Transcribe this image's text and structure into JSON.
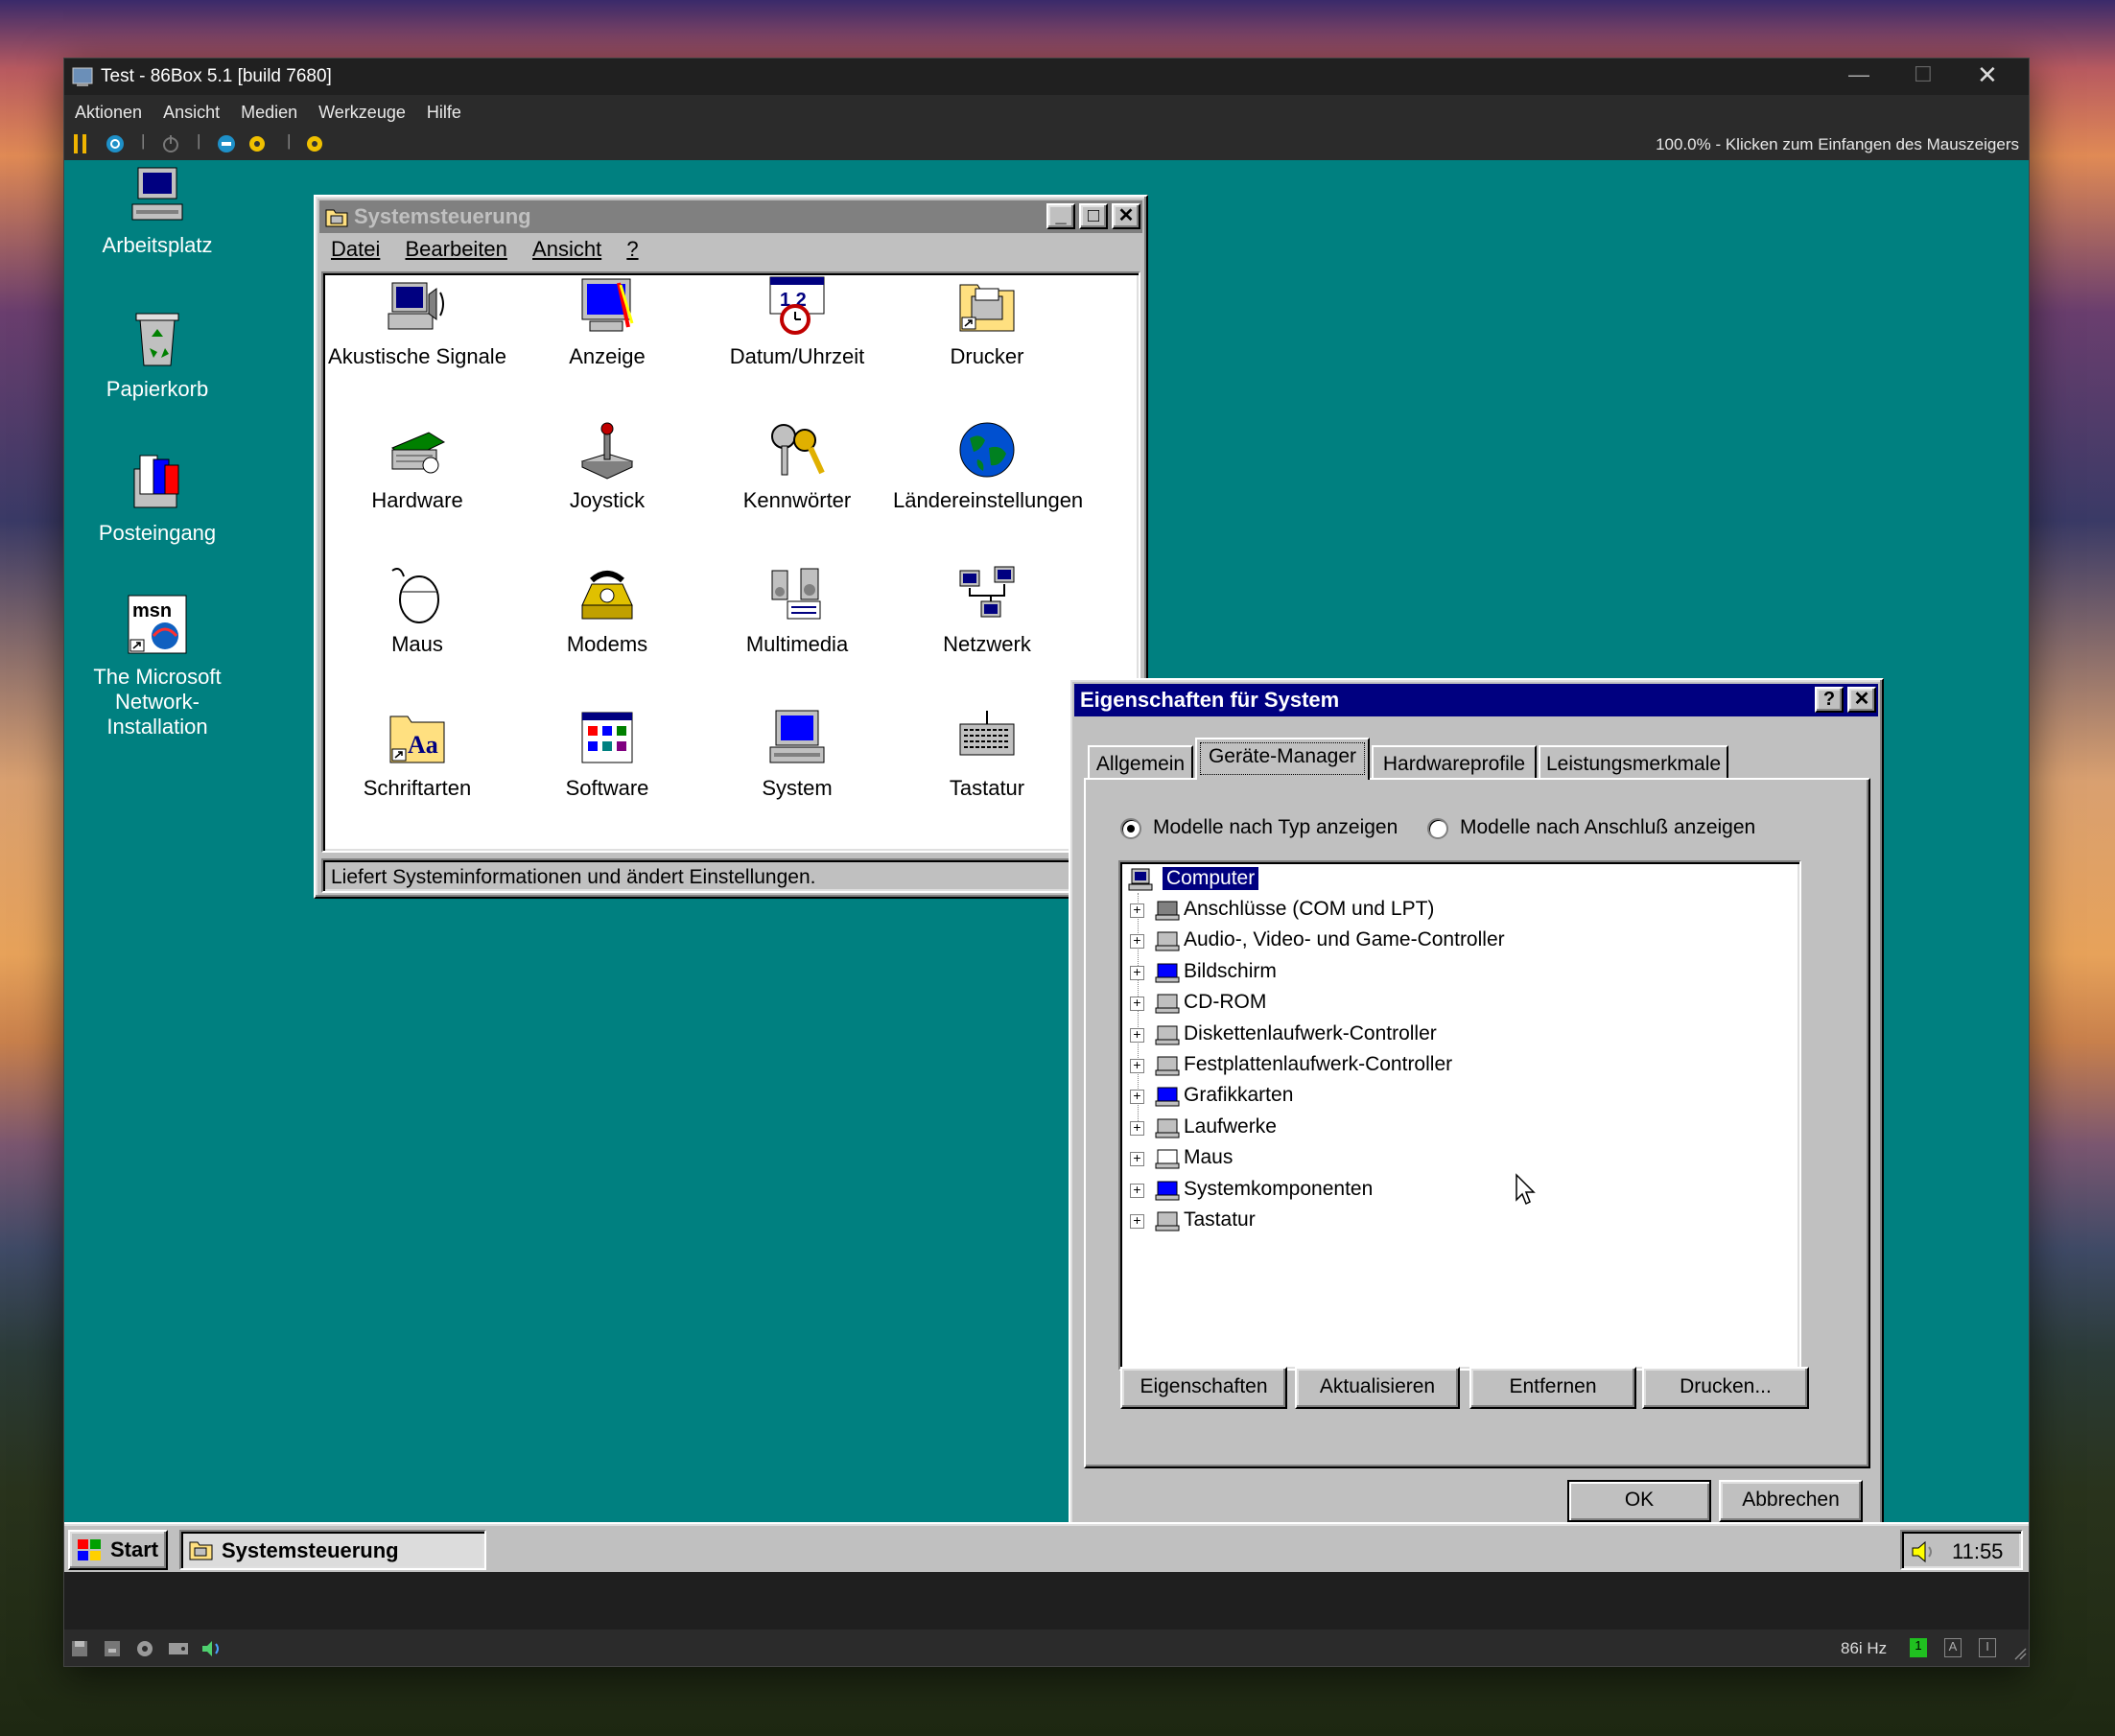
{
  "host": {
    "title": "Test - 86Box 5.1 [build 7680]",
    "menu": [
      "Aktionen",
      "Ansicht",
      "Medien",
      "Werkzeuge",
      "Hilfe"
    ],
    "status_right": "100.0% - Klicken zum Einfangen des Mauszeigers",
    "refresh": "86i Hz"
  },
  "desktop": {
    "icons": [
      "Arbeitsplatz",
      "Papierkorb",
      "Posteingang",
      "The Microsoft Network-Installation"
    ]
  },
  "cp": {
    "title": "Systemsteuerung",
    "menu": [
      "Datei",
      "Bearbeiten",
      "Ansicht",
      "?"
    ],
    "items": [
      "Akustische Signale",
      "Anzeige",
      "Datum/Uhrzeit",
      "Drucker",
      "Hardware",
      "Joystick",
      "Kennwörter",
      "Ländereinstellungen",
      "Maus",
      "Modems",
      "Multimedia",
      "Netzwerk",
      "Schriftarten",
      "Software",
      "System",
      "Tastatur"
    ],
    "status": "Liefert Systeminformationen und ändert Einstellungen."
  },
  "sys": {
    "title": "Eigenschaften für System",
    "tabs": [
      "Allgemein",
      "Geräte-Manager",
      "Hardwareprofile",
      "Leistungsmerkmale"
    ],
    "radio_type": "Modelle nach Typ anzeigen",
    "radio_conn": "Modelle nach Anschluß anzeigen",
    "radio_selected": "type",
    "root": "Computer",
    "devices": [
      "Anschlüsse (COM und LPT)",
      "Audio-, Video- und Game-Controller",
      "Bildschirm",
      "CD-ROM",
      "Diskettenlaufwerk-Controller",
      "Festplattenlaufwerk-Controller",
      "Grafikkarten",
      "Laufwerke",
      "Maus",
      "Systemkomponenten",
      "Tastatur"
    ],
    "btn_props": "Eigenschaften",
    "btn_refresh": "Aktualisieren",
    "btn_remove": "Entfernen",
    "btn_print": "Drucken...",
    "btn_ok": "OK",
    "btn_cancel": "Abbrechen"
  },
  "taskbar": {
    "start": "Start",
    "task": "Systemsteuerung",
    "clock": "11:55"
  },
  "colors": {
    "desktop": "#008080",
    "title_active": "#000080",
    "title_inactive": "#808080",
    "face": "#c0c0c0"
  }
}
